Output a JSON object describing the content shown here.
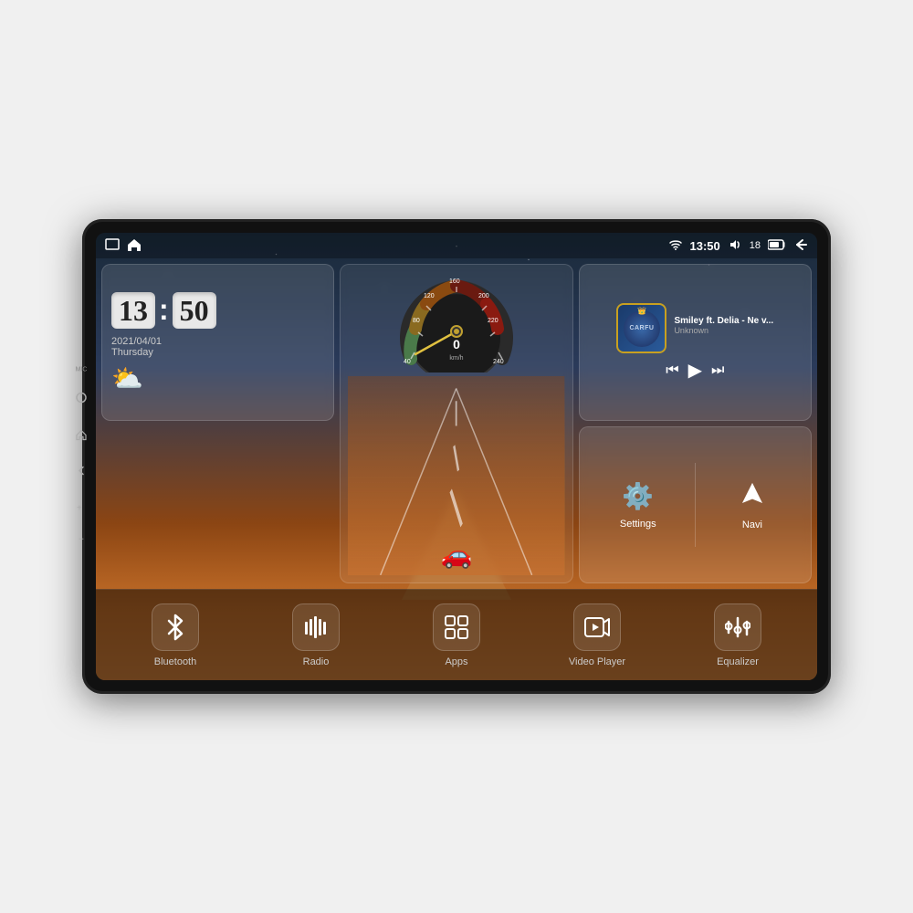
{
  "device": {
    "screen": {
      "status_bar": {
        "mic_label": "MIC",
        "time": "13:50",
        "volume_label": "18",
        "wifi_signal": "▼",
        "icons": [
          "home-outline",
          "home-filled",
          "wifi",
          "volume",
          "battery",
          "back"
        ]
      },
      "clock_widget": {
        "time_h": "13",
        "time_m": "50",
        "date": "2021/04/01",
        "day": "Thursday",
        "weather_icon": "⛅"
      },
      "speedometer_widget": {
        "speed": "0",
        "unit": "km/h",
        "max": "240"
      },
      "music_widget": {
        "title": "Smiley ft. Delia - Ne v...",
        "artist": "Unknown",
        "logo_text": "CARFU",
        "controls": {
          "prev": "⏮",
          "play": "▶",
          "next": "⏭"
        }
      },
      "settings_widget": {
        "label": "Settings",
        "icon": "⚙"
      },
      "navi_widget": {
        "label": "Navi",
        "icon": "⬆"
      },
      "bottom_bar": {
        "buttons": [
          {
            "id": "bluetooth",
            "label": "Bluetooth",
            "icon": "bluetooth"
          },
          {
            "id": "radio",
            "label": "Radio",
            "icon": "radio"
          },
          {
            "id": "apps",
            "label": "Apps",
            "icon": "apps"
          },
          {
            "id": "video-player",
            "label": "Video Player",
            "icon": "video"
          },
          {
            "id": "equalizer",
            "label": "Equalizer",
            "icon": "equalizer"
          }
        ]
      }
    }
  }
}
